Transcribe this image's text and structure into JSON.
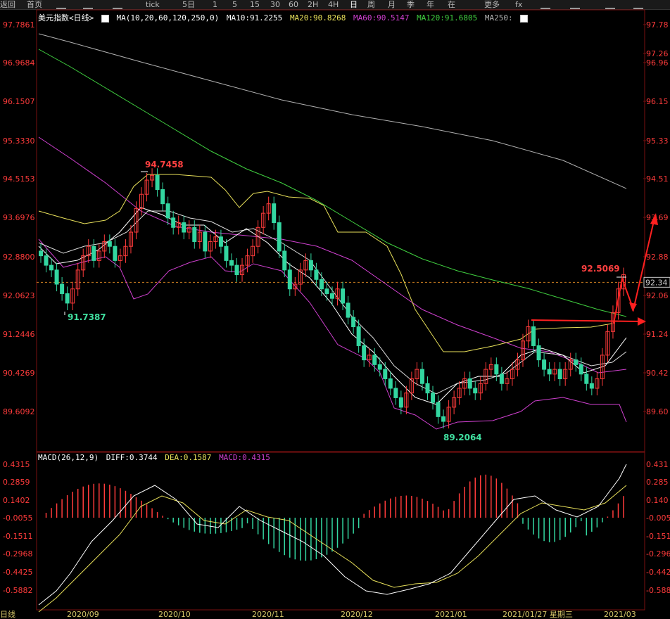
{
  "toolbar": {
    "items": [
      "返回",
      "首页",
      "",
      "",
      "",
      "tick",
      "5日",
      "1",
      "5",
      "15",
      "30",
      "60",
      "2H",
      "4H",
      "日",
      "周",
      "月",
      "季",
      "年",
      "在",
      "更多",
      "fx",
      "",
      "",
      "",
      ""
    ],
    "active": "日"
  },
  "header": {
    "symbol": "美元指数<日线>",
    "ma_params": "MA(10,20,60,120,250,0)",
    "ma10": "MA10:91.2255",
    "ma20": "MA20:90.8268",
    "ma60": "MA60:90.5147",
    "ma120": "MA120:91.6805",
    "ma250": "MA250:"
  },
  "yaxis_left": [
    "97.7861",
    "96.9684",
    "96.1507",
    "95.3330",
    "94.5153",
    "93.6976",
    "92.8800",
    "92.0623",
    "91.2446",
    "90.4269",
    "89.6092"
  ],
  "yaxis_right": [
    "97.78",
    "97.26",
    "96.96",
    "96.15",
    "95.33",
    "94.51",
    "93.69",
    "92.88",
    "92.06",
    "91.24",
    "90.42",
    "89.60"
  ],
  "current_price_tag": "92.34",
  "annotations": {
    "high": "94.7458",
    "low_left": "91.7387",
    "low_bottom": "89.2064",
    "recent_high": "92.5069"
  },
  "macd": {
    "header": "MACD(26,12,9)",
    "diff": "DIFF:0.3744",
    "dea": "DEA:0.1587",
    "macd": "MACD:0.4315",
    "yaxis_left": [
      "0.4315",
      "0.2859",
      "0.1402",
      "-0.0055",
      "-0.1511",
      "-0.2968",
      "-0.4425",
      "-0.5882"
    ],
    "yaxis_right": [
      "0.431",
      "0.285",
      "0.140",
      "-0.005",
      "-0.151",
      "-0.296",
      "-0.442",
      "-0.588"
    ]
  },
  "xaxis": [
    "2020/09",
    "2020/10",
    "2020/11",
    "2020/12",
    "2021/01",
    "2021/01/27  星期三",
    "2021/03"
  ],
  "bottom_label": "日线",
  "colors": {
    "up": "#ff3b3b",
    "down": "#33d6a0",
    "ma10": "#ffffff",
    "ma20": "#e8e05a",
    "ma60": "#d040d0",
    "ma120": "#40d040",
    "ma250": "#b0b0b0",
    "arrow": "#ff2020"
  }
}
